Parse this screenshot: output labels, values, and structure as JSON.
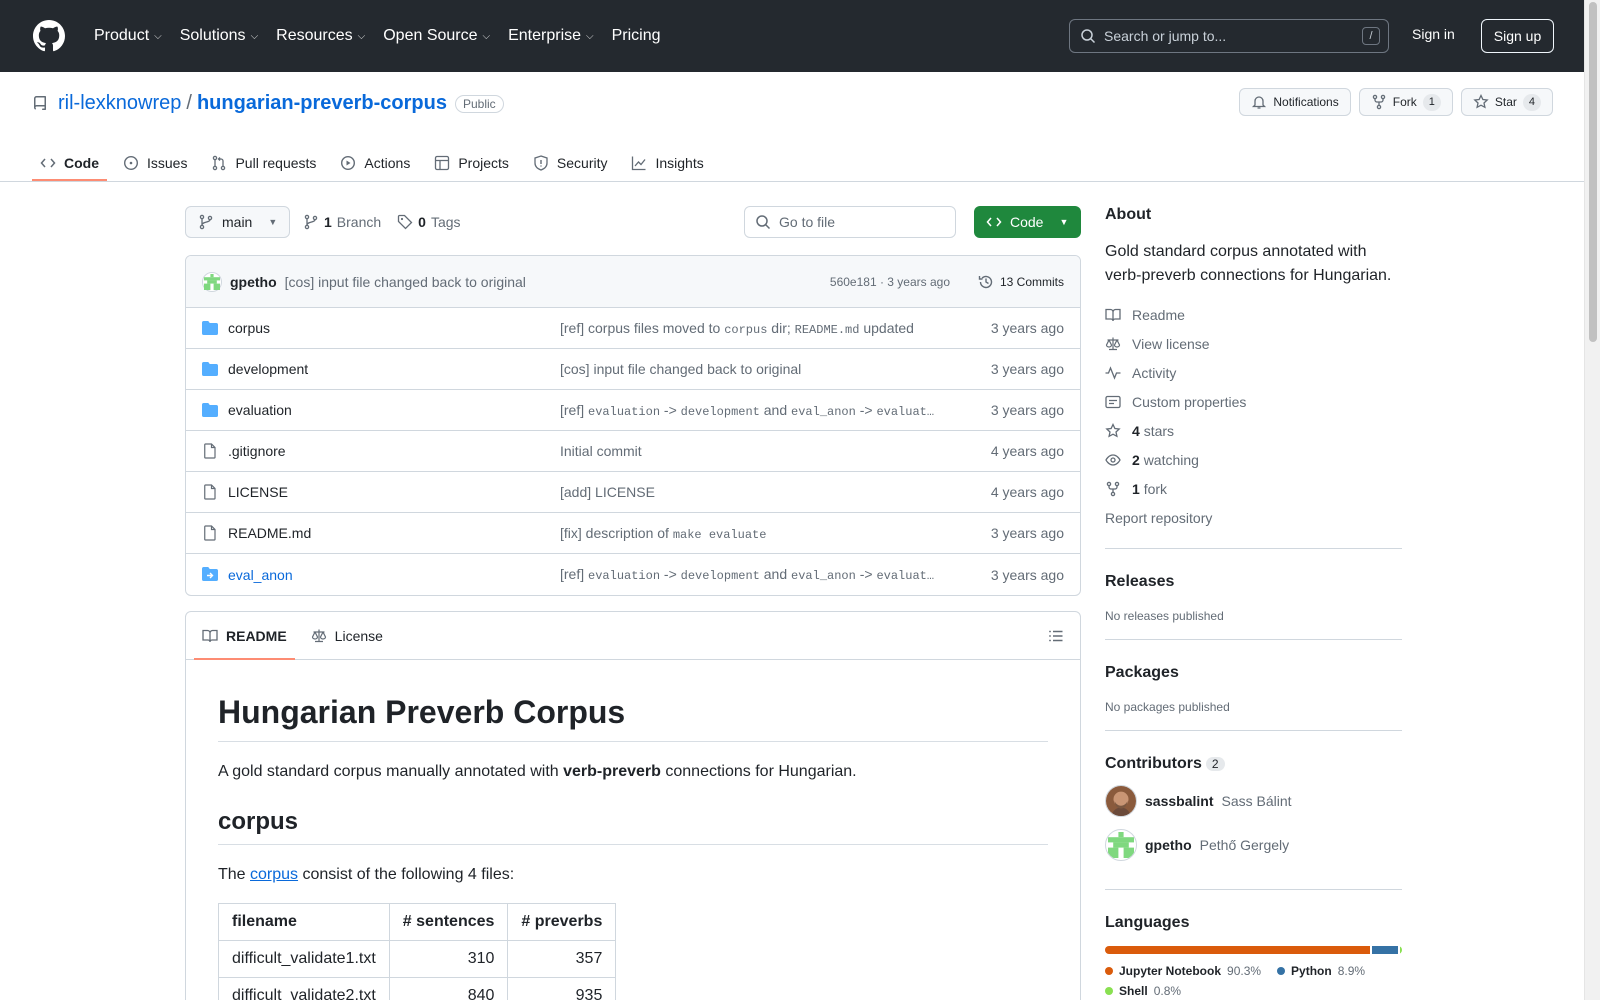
{
  "header": {
    "nav": [
      "Product",
      "Solutions",
      "Resources",
      "Open Source",
      "Enterprise",
      "Pricing"
    ],
    "search_placeholder": "Search or jump to...",
    "search_shortcut": "/",
    "sign_in": "Sign in",
    "sign_up": "Sign up"
  },
  "repo": {
    "owner": "ril-lexknowrep",
    "separator": "/",
    "name": "hungarian-preverb-corpus",
    "visibility": "Public",
    "notifications": "Notifications",
    "fork_label": "Fork",
    "fork_count": "1",
    "star_label": "Star",
    "star_count": "4"
  },
  "tabs": [
    "Code",
    "Issues",
    "Pull requests",
    "Actions",
    "Projects",
    "Security",
    "Insights"
  ],
  "branchbar": {
    "branch": "main",
    "branch_count": "1",
    "branch_word": "Branch",
    "tag_count": "0",
    "tag_word": "Tags",
    "goto_placeholder": "Go to file",
    "code_button": "Code"
  },
  "latest_commit": {
    "author": "gpetho",
    "message": "[cos] input file changed back to original",
    "hash_time": "560e181 · 3 years ago",
    "commits": "13 Commits"
  },
  "files": [
    {
      "name": "corpus",
      "type": "folder",
      "msg": [
        "[ref] corpus files moved to ",
        "corpus",
        " dir; ",
        "README.md",
        " updated"
      ],
      "when": "3 years ago"
    },
    {
      "name": "development",
      "type": "folder",
      "msg": [
        "[cos] input file changed back to original"
      ],
      "when": "3 years ago"
    },
    {
      "name": "evaluation",
      "type": "folder",
      "msg": [
        "[ref] ",
        "evaluation",
        " -> ",
        "development",
        " and ",
        "eval_anon",
        " -> ",
        "evaluat…"
      ],
      "when": "3 years ago"
    },
    {
      "name": ".gitignore",
      "type": "file",
      "msg": [
        "Initial commit"
      ],
      "when": "4 years ago"
    },
    {
      "name": "LICENSE",
      "type": "file",
      "msg": [
        "[add] LICENSE"
      ],
      "when": "4 years ago"
    },
    {
      "name": "README.md",
      "type": "file",
      "msg": [
        "[fix] description of ",
        "make evaluate"
      ],
      "when": "3 years ago"
    },
    {
      "name": "eval_anon",
      "type": "symlink",
      "msg": [
        "[ref] ",
        "evaluation",
        " -> ",
        "development",
        " and ",
        "eval_anon",
        " -> ",
        "evaluat…"
      ],
      "when": "3 years ago"
    }
  ],
  "readme": {
    "tab_readme": "README",
    "tab_license": "License",
    "h1": "Hungarian Preverb Corpus",
    "intro_before": "A gold standard corpus manually annotated with ",
    "intro_bold": "verb-preverb",
    "intro_after": " connections for Hungarian.",
    "h2": "corpus",
    "p2_before": "The ",
    "p2_link": "corpus",
    "p2_after": " consist of the following 4 files:",
    "table": {
      "headers": [
        "filename",
        "# sentences",
        "# preverbs"
      ],
      "rows": [
        [
          "difficult_validate1.txt",
          "310",
          "357"
        ],
        [
          "difficult_validate2.txt",
          "840",
          "935"
        ]
      ]
    }
  },
  "about": {
    "title": "About",
    "description": "Gold standard corpus annotated with verb-preverb connections for Hungarian.",
    "readme": "Readme",
    "license": "View license",
    "activity": "Activity",
    "custom": "Custom properties",
    "stars_n": "4",
    "stars_w": "stars",
    "watch_n": "2",
    "watch_w": "watching",
    "fork_n": "1",
    "fork_w": "fork",
    "report": "Report repository"
  },
  "releases": {
    "title": "Releases",
    "text": "No releases published"
  },
  "packages": {
    "title": "Packages",
    "text": "No packages published"
  },
  "contributors": {
    "title": "Contributors",
    "count": "2",
    "list": [
      {
        "login": "sassbalint",
        "name": "Sass Bálint"
      },
      {
        "login": "gpetho",
        "name": "Pethő Gergely"
      }
    ]
  },
  "languages": {
    "title": "Languages",
    "list": [
      {
        "name": "Jupyter Notebook",
        "pct": "90.3%",
        "value": 90.3,
        "color": "#DA5B0B"
      },
      {
        "name": "Python",
        "pct": "8.9%",
        "value": 8.9,
        "color": "#3572A5"
      },
      {
        "name": "Shell",
        "pct": "0.8%",
        "value": 0.8,
        "color": "#89e051"
      }
    ]
  }
}
